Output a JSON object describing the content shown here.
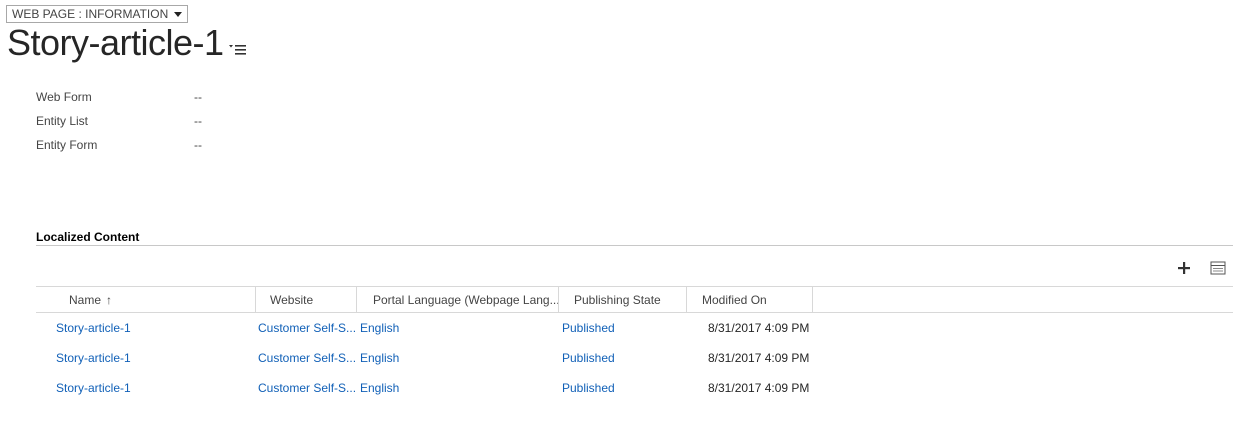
{
  "form_selector": {
    "label": "WEB PAGE : INFORMATION"
  },
  "record": {
    "title": "Story-article-1"
  },
  "fields": [
    {
      "label": "Web Form",
      "value": "--"
    },
    {
      "label": "Entity List",
      "value": "--"
    },
    {
      "label": "Entity Form",
      "value": "--"
    }
  ],
  "localized_content": {
    "title": "Localized Content",
    "columns": [
      "Name",
      "Website",
      "Portal Language (Webpage Lang...",
      "Publishing State",
      "Modified On"
    ],
    "rows": [
      {
        "name": "Story-article-1",
        "website": "Customer Self-S...",
        "language": "English",
        "state": "Published",
        "modified": "8/31/2017 4:09 PM"
      },
      {
        "name": "Story-article-1",
        "website": "Customer Self-S...",
        "language": "English",
        "state": "Published",
        "modified": "8/31/2017 4:09 PM"
      },
      {
        "name": "Story-article-1",
        "website": "Customer Self-S...",
        "language": "English",
        "state": "Published",
        "modified": "8/31/2017 4:09 PM"
      }
    ]
  },
  "colors": {
    "link": "#1160b7",
    "text": "#444444",
    "rule": "#c8c8c8"
  }
}
